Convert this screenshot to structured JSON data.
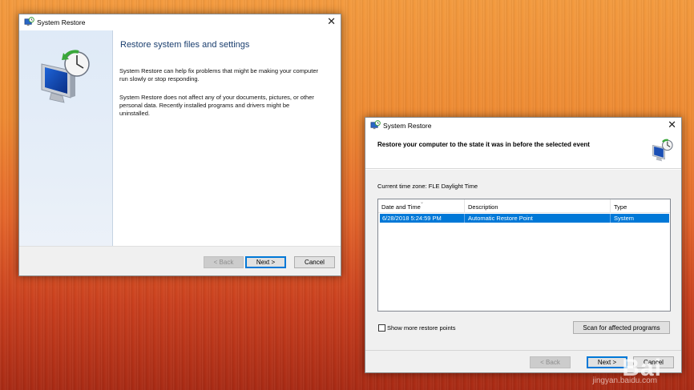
{
  "window1": {
    "title": "System Restore",
    "heading": "Restore system files and settings",
    "paragraph1": "System Restore can help fix problems that might be making your computer run slowly or stop responding.",
    "paragraph2": "System Restore does not affect any of your documents, pictures, or other personal data. Recently installed programs and drivers might be uninstalled.",
    "back_label": "< Back",
    "next_label": "Next >",
    "cancel_label": "Cancel",
    "close_glyph": "✕"
  },
  "window2": {
    "title": "System Restore",
    "header_title": "Restore your computer to the state it was in before the selected event",
    "timezone": "Current time zone: FLE Daylight Time",
    "columns": [
      "Date and Time",
      "Description",
      "Type"
    ],
    "rows": [
      {
        "date": "6/28/2018 5:24:59 PM",
        "description": "Automatic Restore Point",
        "type": "System"
      }
    ],
    "show_more_label": "Show more restore points",
    "scan_label": "Scan for affected programs",
    "back_label": "< Back",
    "next_label": "Next >",
    "cancel_label": "Cancel",
    "close_glyph": "✕"
  },
  "watermark": {
    "text": "Bai",
    "sub": "jingyan.baidu.com"
  },
  "colors": {
    "selection": "#0078d7",
    "heading": "#1a3e6e"
  },
  "icons": [
    "system-restore-icon",
    "monitor-restore-icon",
    "close-icon"
  ]
}
